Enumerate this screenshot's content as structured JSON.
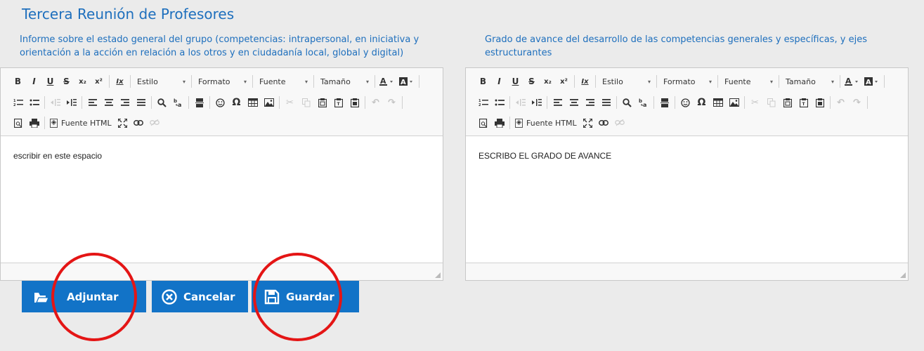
{
  "page": {
    "title": "Tercera Reunión de Profesores",
    "left_label": "Informe sobre el estado general del grupo (competencias: intrapersonal, en iniciativa y orientación a la acción en relación a los otros y en ciudadanía local, global y digital)",
    "right_label": "Grado de avance del desarrollo de las competencias generales y específicas, y ejes estructurantes"
  },
  "toolbar": {
    "style_label": "Estilo",
    "format_label": "Formato",
    "font_label": "Fuente",
    "size_label": "Tamaño",
    "source_label": "Fuente HTML",
    "bold": "B",
    "italic": "I",
    "underline": "U",
    "strike": "S",
    "subscript": "x₂",
    "superscript": "x²",
    "remove_format": "Ix"
  },
  "editors": {
    "left_content": "escribir en este espacio",
    "right_content": "ESCRIBO EL GRADO DE AVANCE"
  },
  "buttons": {
    "attach": "Adjuntar",
    "cancel": "Cancelar",
    "save": "Guardar"
  },
  "colors": {
    "accent": "#1e6fbd",
    "button": "#1273c7",
    "annotation": "#e41515",
    "background": "#ebebeb"
  }
}
